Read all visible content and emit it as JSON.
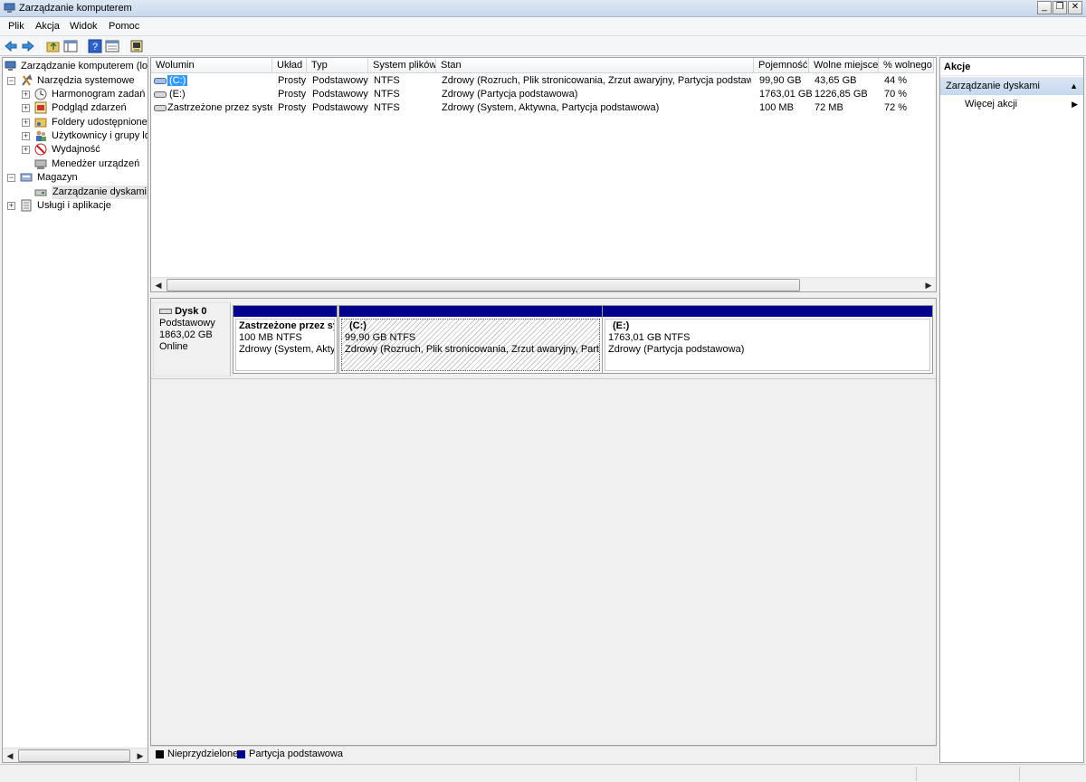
{
  "window": {
    "title": "Zarządzanie komputerem",
    "buttons": {
      "minimize": "_",
      "restore": "❐",
      "close": "✕"
    }
  },
  "menu": [
    "Plik",
    "Akcja",
    "Widok",
    "Pomoc"
  ],
  "tree": {
    "root": "Zarządzanie komputerem (loka",
    "system_tools": "Narzędzia systemowe",
    "task_scheduler": "Harmonogram zadań",
    "event_viewer": "Podgląd zdarzeń",
    "shared_folders": "Foldery udostępnione",
    "users_groups": "Użytkownicy i grupy lok",
    "performance": "Wydajność",
    "device_manager": "Menedżer urządzeń",
    "storage": "Magazyn",
    "disk_management": "Zarządzanie dyskami",
    "services_apps": "Usługi i aplikacje"
  },
  "volumes": {
    "columns": [
      "Wolumin",
      "Układ",
      "Typ",
      "System plików",
      "Stan",
      "Pojemność",
      "Wolne miejsce",
      "% wolnego"
    ],
    "rows": [
      {
        "name": "(C:)",
        "layout": "Prosty",
        "type": "Podstawowy",
        "fs": "NTFS",
        "status": "Zdrowy (Rozruch, Plik stronicowania, Zrzut awaryjny, Partycja podstawowa)",
        "capacity": "99,90 GB",
        "free": "43,65 GB",
        "pct": "44 %"
      },
      {
        "name": "(E:)",
        "layout": "Prosty",
        "type": "Podstawowy",
        "fs": "NTFS",
        "status": "Zdrowy (Partycja podstawowa)",
        "capacity": "1763,01 GB",
        "free": "1226,85 GB",
        "pct": "70 %"
      },
      {
        "name": "Zastrzeżone przez system",
        "layout": "Prosty",
        "type": "Podstawowy",
        "fs": "NTFS",
        "status": "Zdrowy (System, Aktywna, Partycja podstawowa)",
        "capacity": "100 MB",
        "free": "72 MB",
        "pct": "72 %"
      }
    ]
  },
  "disk": {
    "name": "Dysk 0",
    "type": "Podstawowy",
    "size": "1863,02 GB",
    "state": "Online",
    "partitions": [
      {
        "title": "Zastrzeżone przez sys",
        "size": "100 MB NTFS",
        "status": "Zdrowy (System, Aktyw"
      },
      {
        "title": "(C:)",
        "size": "99,90 GB NTFS",
        "status": "Zdrowy (Rozruch, Plik stronicowania, Zrzut awaryjny, Partycja"
      },
      {
        "title": "(E:)",
        "size": "1763,01 GB NTFS",
        "status": "Zdrowy (Partycja podstawowa)"
      }
    ]
  },
  "legend": {
    "unallocated": "Nieprzydzielone",
    "primary": "Partycja podstawowa",
    "unallocated_color": "#000000",
    "primary_color": "#00008b"
  },
  "actions": {
    "header": "Akcje",
    "section": "Zarządzanie dyskami",
    "more": "Więcej akcji"
  },
  "icons": {
    "back": "arrow-left-icon",
    "forward": "arrow-right-icon",
    "up": "folder-up-icon",
    "show_hide": "console-tree-icon",
    "help": "help-icon",
    "properties": "properties-icon",
    "export": "export-icon"
  },
  "colors": {
    "selection": "#3399ff",
    "partition_bar": "#00008b",
    "action_section": "#c6d8ef"
  }
}
